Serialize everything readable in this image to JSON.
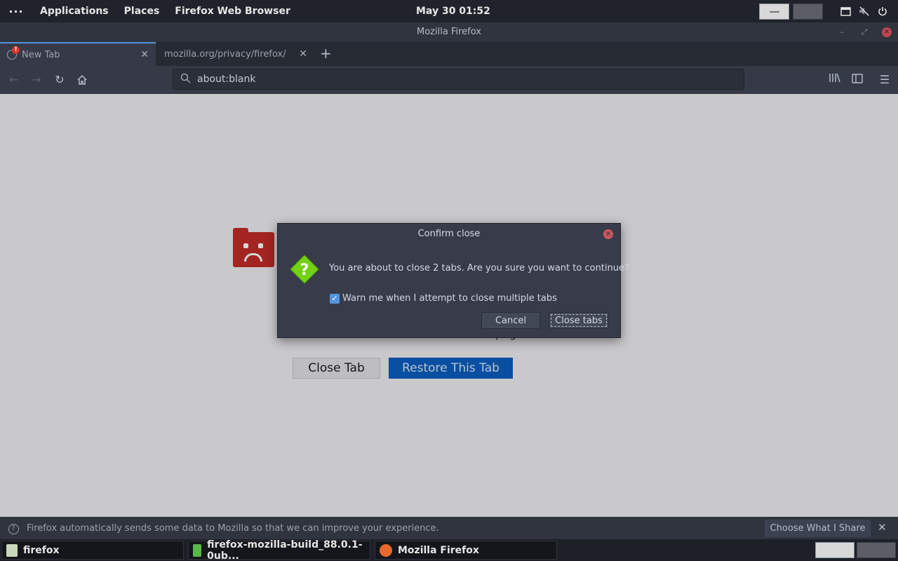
{
  "top_panel": {
    "activities_label": "···",
    "menus": [
      "Applications",
      "Places",
      "Firefox Web Browser"
    ],
    "clock": "May 30  01:52"
  },
  "window": {
    "title": "Mozilla Firefox"
  },
  "tabs": [
    {
      "label": "New Tab",
      "active": true
    },
    {
      "label": "mozilla.org/privacy/firefox/",
      "active": false
    }
  ],
  "nav": {
    "url": "about:blank"
  },
  "content": {
    "partial_text": "pag",
    "close_tab_label": "Close Tab",
    "restore_tab_label": "Restore This Tab"
  },
  "dialog": {
    "title": "Confirm close",
    "message": "You are about to close 2 tabs. Are you sure you want to continue?",
    "checkbox_label": "Warn me when I attempt to close multiple tabs",
    "checkbox_checked": true,
    "cancel_label": "Cancel",
    "confirm_label": "Close tabs"
  },
  "notification": {
    "text": "Firefox automatically sends some data to Mozilla so that we can improve your experience.",
    "button_label": "Choose What I Share"
  },
  "taskbar": {
    "items": [
      {
        "label": "firefox"
      },
      {
        "label": "firefox-mozilla-build_88.0.1-0ub..."
      },
      {
        "label": "Mozilla Firefox"
      }
    ]
  },
  "colors": {
    "accent": "#5294e2",
    "restore_button": "#0a5fc0",
    "sad_tab_red": "#c42c28",
    "question_icon_green": "#73d216",
    "close_red": "#cc575d"
  }
}
